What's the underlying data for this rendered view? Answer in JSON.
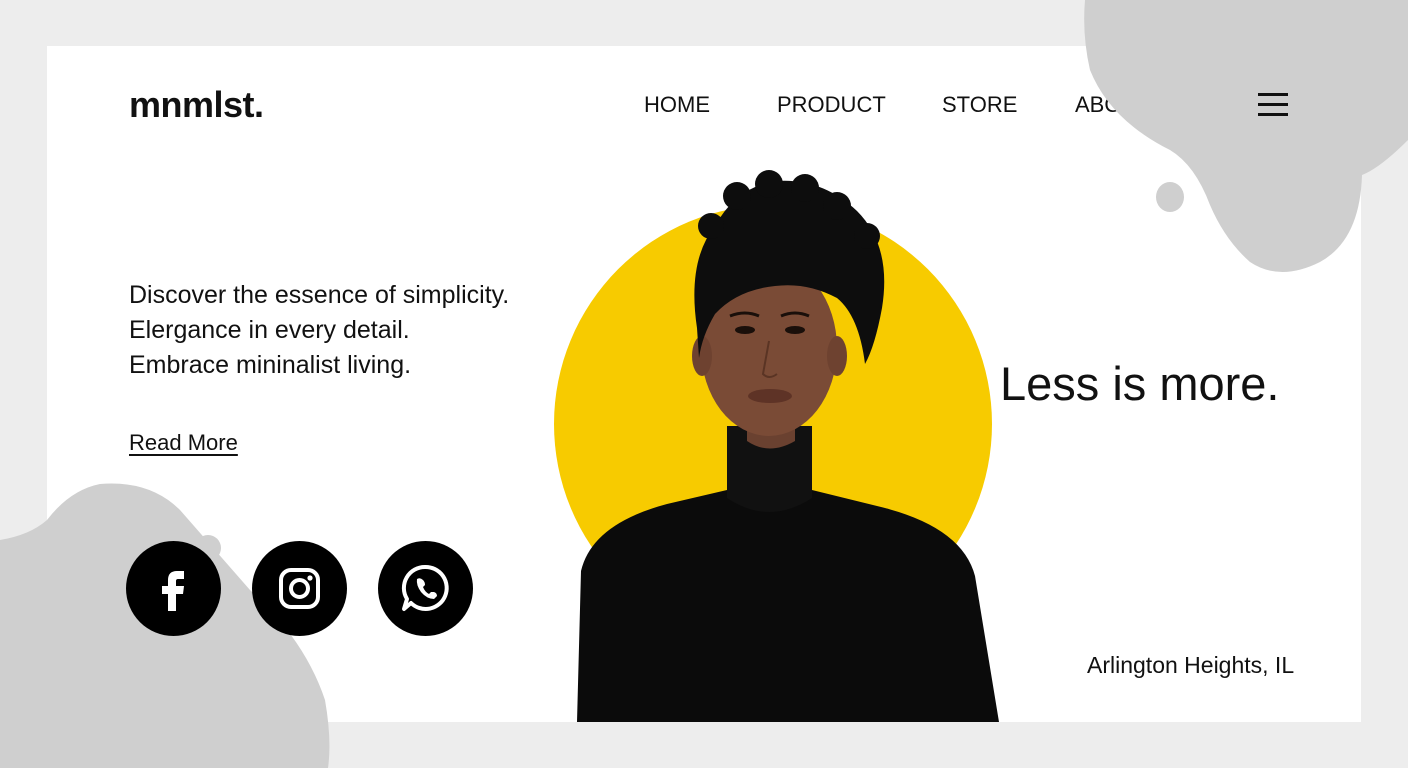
{
  "brand": {
    "logo": "mnmlst."
  },
  "nav": {
    "items": [
      {
        "label": "HOME"
      },
      {
        "label": "PRODUCT"
      },
      {
        "label": "STORE"
      },
      {
        "label": "ABOUT US"
      }
    ],
    "menu_icon": "hamburger-menu-icon"
  },
  "hero": {
    "tagline": [
      "Discover the essence of simplicity.",
      "Elergance in every detail.",
      "Embrace mininalist living."
    ],
    "read_more": "Read More",
    "slogan": "Less is more.",
    "location": "Arlington Heights, IL",
    "accent_color": "#f7cb00"
  },
  "social": [
    {
      "icon": "facebook-icon"
    },
    {
      "icon": "instagram-icon"
    },
    {
      "icon": "whatsapp-icon"
    }
  ],
  "colors": {
    "background": "#ededed",
    "card": "#ffffff",
    "blob": "#cfcfcf",
    "text": "#111111",
    "accent": "#f7cb00"
  }
}
